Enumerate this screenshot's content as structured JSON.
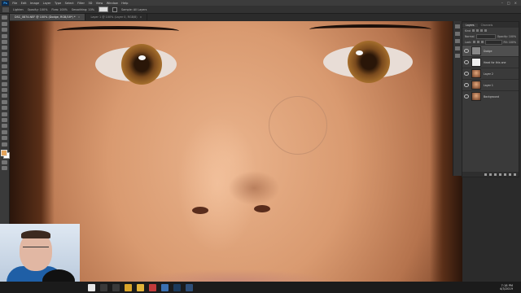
{
  "app": {
    "logo": "Ps"
  },
  "menu": [
    "File",
    "Edit",
    "Image",
    "Layer",
    "Type",
    "Select",
    "Filter",
    "3D",
    "View",
    "Window",
    "Help"
  ],
  "window_controls": [
    "–",
    "□",
    "×"
  ],
  "options": {
    "mode_label": "Lighten",
    "opacity_label": "Opacity: 100%",
    "flow_label": "Flow: 100%",
    "smoothing_label": "Smoothing: 10%",
    "sample_label": "Sample: All Layers"
  },
  "doc_tabs": [
    {
      "label": "DSC_0874.NEF @ 100% (Dodge, RGB/16*) *",
      "active": true
    },
    {
      "label": "Layer 1 @ 100% (Layer 0, RGB/8)",
      "active": false
    }
  ],
  "panels": {
    "tabs": [
      "Layers",
      "Channels"
    ],
    "kind_label": "Kind",
    "blend_label": "Normal",
    "opacity_label": "Opacity: 100%",
    "lock_label": "Lock:",
    "fill_label": "Fill: 100%",
    "layers": [
      {
        "name": "Dodge",
        "thumb": "grey",
        "selected": true
      },
      {
        "name": "Head for this one",
        "thumb": "white",
        "selected": false
      },
      {
        "name": "Layer 2",
        "thumb": "photo",
        "selected": false
      },
      {
        "name": "Layer 1",
        "thumb": "photo",
        "selected": false
      },
      {
        "name": "Background",
        "thumb": "photo",
        "selected": false
      }
    ]
  },
  "colors": {
    "foreground": "#e5a45c",
    "background": "#ffffff",
    "accent": "#31a8ff"
  },
  "taskbar": {
    "apps": [
      {
        "icon": "windows-icon",
        "color": "#e6e6e6"
      },
      {
        "icon": "search-icon",
        "color": "#3a3a3a"
      },
      {
        "icon": "task-view-icon",
        "color": "#3a3a3a"
      },
      {
        "icon": "chrome-icon",
        "color": "#d9a42a"
      },
      {
        "icon": "explorer-icon",
        "color": "#e2b33a"
      },
      {
        "icon": "media-icon",
        "color": "#c23b3b"
      },
      {
        "icon": "app-icon",
        "color": "#3a6fb0"
      },
      {
        "icon": "photoshop-icon",
        "color": "#1b3a5c"
      },
      {
        "icon": "lightroom-icon",
        "color": "#2f4f78"
      }
    ],
    "time": "7:18 PM",
    "date": "4/3/2019"
  }
}
